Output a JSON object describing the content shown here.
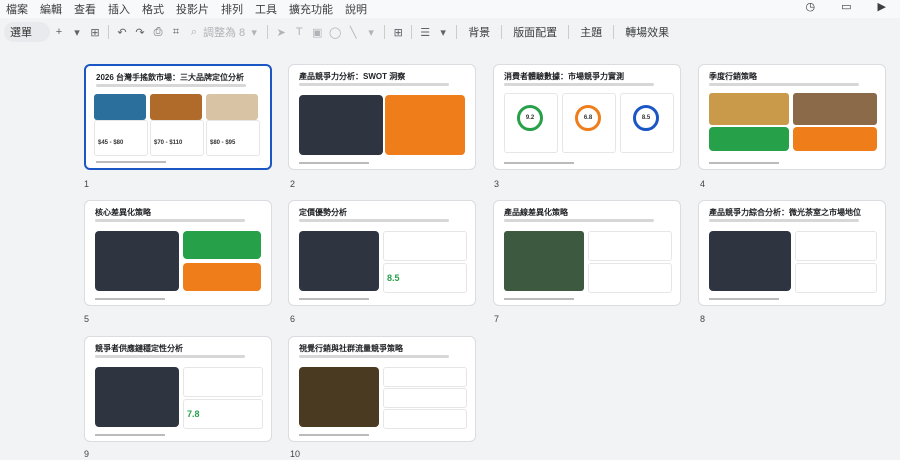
{
  "menu": [
    "檔案",
    "編輯",
    "查看",
    "插入",
    "格式",
    "投影片",
    "排列",
    "工具",
    "擴充功能",
    "說明"
  ],
  "toolbar": {
    "select_label": "選單",
    "adjust_label": "調整為 8",
    "background_label": "背景",
    "layout_label": "版面配置",
    "theme_label": "主題",
    "transition_label": "轉場效果"
  },
  "slides": [
    {
      "number": "1",
      "title": "2026 台灣手搖飲市場：三大品牌定位分析",
      "prices": [
        "$45 - $80",
        "$70 - $110",
        "$80 - $95"
      ]
    },
    {
      "number": "2",
      "title": "產品競爭力分析：SWOT 洞察"
    },
    {
      "number": "3",
      "title": "消費者體驗數據：市場競爭力實測",
      "scores": [
        "9.2",
        "6.8",
        "8.5"
      ]
    },
    {
      "number": "4",
      "title": "季度行銷策略"
    },
    {
      "number": "5",
      "title": "核心差異化策略"
    },
    {
      "number": "6",
      "title": "定價優勢分析",
      "score": "8.5"
    },
    {
      "number": "7",
      "title": "產品線差異化策略"
    },
    {
      "number": "8",
      "title": "產品競爭力綜合分析：微光茶室之市場地位"
    },
    {
      "number": "9",
      "title": "競爭者供應鏈穩定性分析",
      "score": "7.8"
    },
    {
      "number": "10",
      "title": "視覺行銷與社群流量競爭策略"
    }
  ],
  "colors": {
    "accent": "#1a56c4",
    "green": "#27a04a",
    "orange": "#ef7d1a",
    "dark": "#2f3540"
  }
}
